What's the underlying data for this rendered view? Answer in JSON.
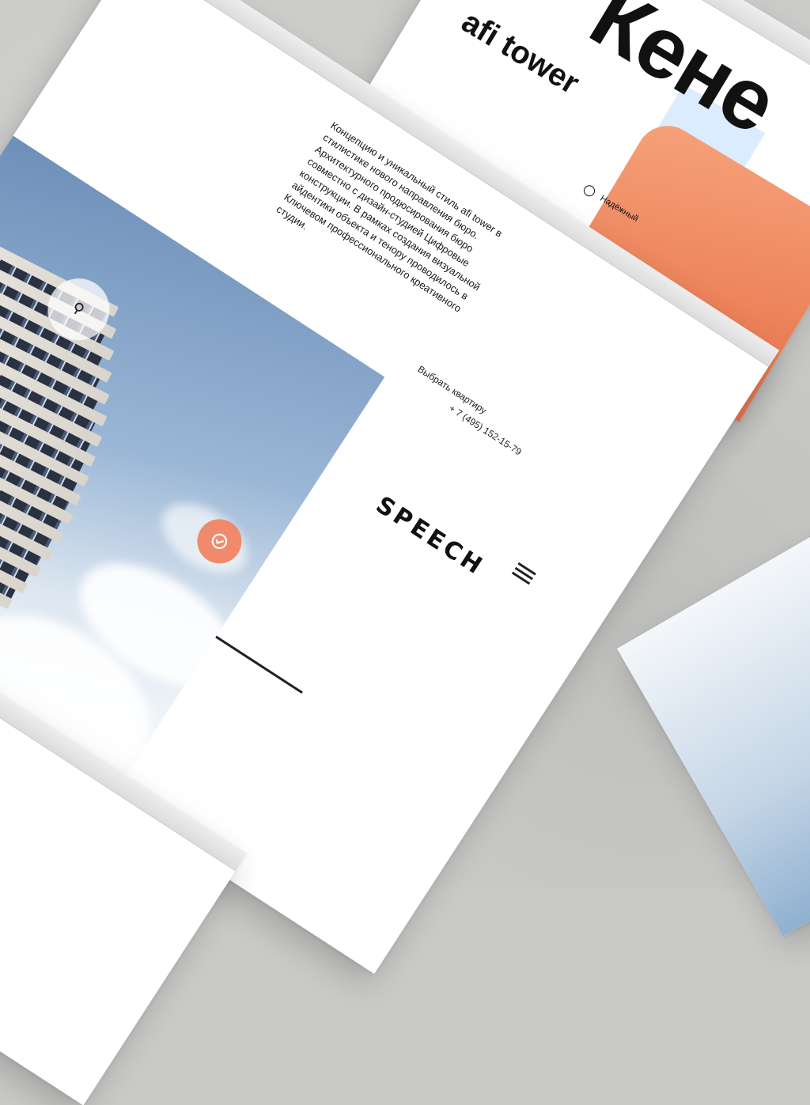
{
  "main": {
    "description": "Концепцию и уникальный стиль afi tower в стилистике нового направления бюро. Архитектурного продюсирования бюро совместно с дизайн-студией Цифровые конструкции. В рамках создания визуальной айдентики объекта и тенору проводилось в Ключевом профессионального креативного студии.",
    "choose_label": "Выбрать квартиру",
    "phone": "+ 7 (495) 152-15-79",
    "logo": "SPEECH",
    "search_icon": "search-icon",
    "chat_icon": "chat-icon",
    "menu_icon": "menu-icon"
  },
  "right_top": {
    "title": "afi tower",
    "big_text": "Кене",
    "caption": "Надёжный"
  },
  "colors": {
    "accent": "#f08a6b",
    "sky": "#6d8fb9",
    "background": "#cbcbc9"
  }
}
